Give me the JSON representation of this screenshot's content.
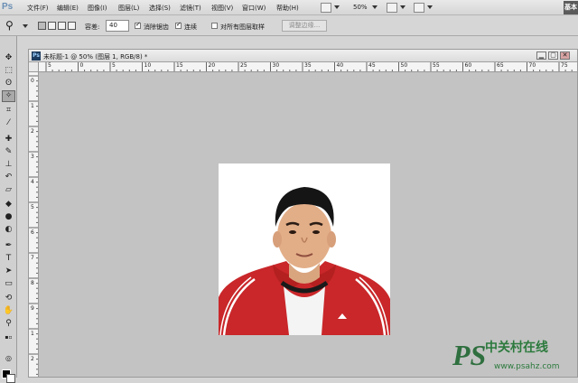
{
  "app": {
    "logo": "Ps",
    "workspace": "基本"
  },
  "menu": [
    "文件(F)",
    "编辑(E)",
    "图像(I)",
    "图层(L)",
    "选择(S)",
    "滤镜(T)",
    "视图(V)",
    "窗口(W)",
    "帮助(H)"
  ],
  "menubar": {
    "zoom": "50%"
  },
  "options": {
    "tolerance_label": "容差:",
    "tolerance_value": "40",
    "anti_alias_label": "消除锯齿",
    "anti_alias_checked": true,
    "contiguous_label": "连续",
    "contiguous_checked": true,
    "sample_all_layers_label": "对所有图层取样",
    "sample_all_layers_checked": false,
    "refine_edge_label": "调整边缘..."
  },
  "document": {
    "title": "未标题-1 @ 50% (图层 1, RGB/8) *",
    "ruler_h": [
      "5",
      "0",
      "5",
      "10",
      "15",
      "20",
      "25",
      "30",
      "35",
      "40",
      "45",
      "50",
      "55",
      "60",
      "65",
      "70",
      "75"
    ],
    "ruler_v": [
      "0",
      "1",
      "2",
      "3",
      "4",
      "5",
      "6",
      "7",
      "8",
      "9",
      "1",
      "2"
    ]
  },
  "colors": {
    "foreground": "#000000",
    "background": "#ffffff",
    "jacket": "#c9272a"
  },
  "watermark": {
    "logo": "PS",
    "line1": "中关村在线",
    "line2": "www.psahz.com"
  }
}
